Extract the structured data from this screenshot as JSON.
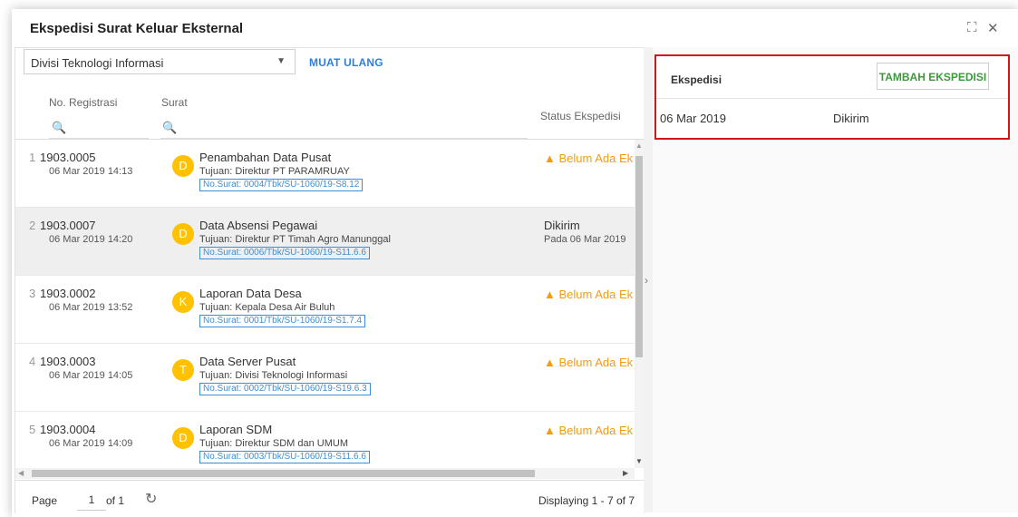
{
  "window": {
    "title": "Ekspedisi Surat Keluar Eksternal",
    "maximize_icon": "⛶",
    "close_icon": "✕"
  },
  "toolbar": {
    "division_value": "Divisi Teknologi Informasi",
    "caret": "▼",
    "reload_label": "MUAT ULANG"
  },
  "grid": {
    "col_registration": "No. Registrasi",
    "col_letter": "Surat",
    "col_status": "Status Ekspedisi",
    "search_icon": "🔍"
  },
  "rows": [
    {
      "num": "1",
      "reg": "1903.0005",
      "date": "06 Mar 2019 14:13",
      "avatar": "D",
      "subject": "Penambahan Data Pusat",
      "recipient": "Tujuan: Direktur PT PARAMRUAY",
      "letter_no": "No.Surat: 0004/Tbk/SU-1060/19-S8.12",
      "status": "▲ Belum Ada Ek",
      "status_sub": "",
      "status_type": "warning"
    },
    {
      "num": "2",
      "reg": "1903.0007",
      "date": "06 Mar 2019 14:20",
      "avatar": "D",
      "subject": "Data Absensi Pegawai",
      "recipient": "Tujuan: Direktur PT Timah Agro Manunggal",
      "letter_no": "No.Surat: 0006/Tbk/SU-1060/19-S11.6.6",
      "status": "Dikirim",
      "status_sub": "Pada 06 Mar 2019",
      "status_type": "sent"
    },
    {
      "num": "3",
      "reg": "1903.0002",
      "date": "06 Mar 2019 13:52",
      "avatar": "K",
      "subject": "Laporan Data Desa",
      "recipient": "Tujuan: Kepala Desa Air Buluh",
      "letter_no": "No.Surat: 0001/Tbk/SU-1060/19-S1.7.4",
      "status": "▲ Belum Ada Ek",
      "status_sub": "",
      "status_type": "warning"
    },
    {
      "num": "4",
      "reg": "1903.0003",
      "date": "06 Mar 2019 14:05",
      "avatar": "T",
      "subject": "Data Server Pusat",
      "recipient": "Tujuan: Divisi Teknologi Informasi",
      "letter_no": "No.Surat: 0002/Tbk/SU-1060/19-S19.6.3",
      "status": "▲ Belum Ada Ek",
      "status_sub": "",
      "status_type": "warning"
    },
    {
      "num": "5",
      "reg": "1903.0004",
      "date": "06 Mar 2019 14:09",
      "avatar": "D",
      "subject": "Laporan SDM",
      "recipient": "Tujuan: Direktur SDM dan UMUM",
      "letter_no": "No.Surat: 0003/Tbk/SU-1060/19-S11.6.6",
      "status": "▲ Belum Ada Ek",
      "status_sub": "",
      "status_type": "warning"
    }
  ],
  "selected_row": 1,
  "pager": {
    "page_label": "Page",
    "page_value": "1",
    "of_label": "of 1",
    "refresh_icon": "↻",
    "display_text": "Displaying 1 - 7 of 7"
  },
  "splitter": {
    "arrow": "›"
  },
  "expedition_panel": {
    "title": "Ekspedisi",
    "add_button": "TAMBAH EKSPEDISI",
    "rows": [
      {
        "date": "06 Mar 2019",
        "status": "Dikirim"
      }
    ]
  },
  "colors": {
    "accent_blue": "#2f7fd8",
    "warning": "#f39c12",
    "avatar": "#ffc100",
    "add_button_text": "#3b9a3b",
    "highlight_border": "#d4141c"
  },
  "icons": {
    "scroll_up": "▲",
    "scroll_down": "▼",
    "scroll_left": "◀",
    "scroll_right": "▶"
  }
}
